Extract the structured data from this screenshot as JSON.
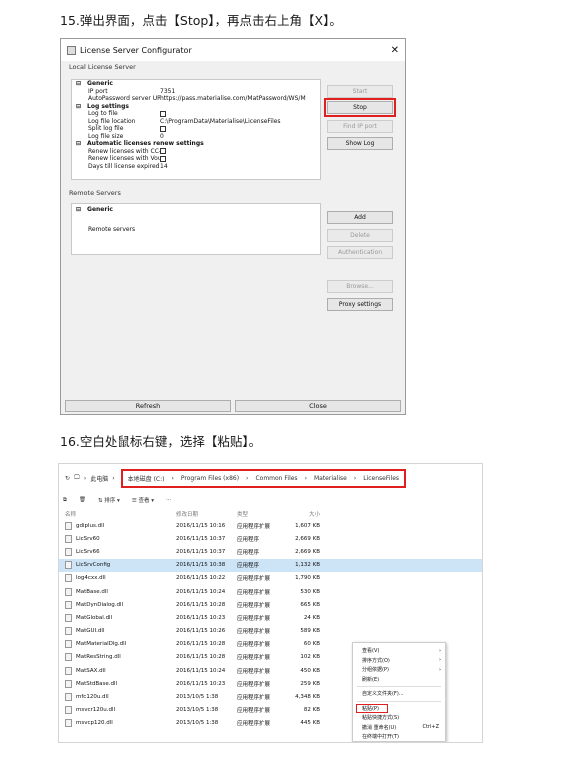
{
  "steps": {
    "step15": "15.弹出界面，点击【Stop】，再点击右上角【X】。",
    "step16": "16.空白处鼠标右键，选择【粘贴】。"
  },
  "dialog": {
    "title": "License Server Configurator",
    "close": "✕",
    "local_section": "Local License Server",
    "rows": [
      {
        "type": "header",
        "label": "Generic"
      },
      {
        "type": "prop",
        "key": "IP port",
        "value": "7351"
      },
      {
        "type": "prop",
        "key": "AutoPassword server URL",
        "value": "https://pass.materialise.com/MatPassword/WS/M"
      },
      {
        "type": "header",
        "label": "Log settings"
      },
      {
        "type": "check",
        "key": "Log to file",
        "value": ""
      },
      {
        "type": "prop",
        "key": "Log file location",
        "value": "C:\\ProgramData\\Materialise\\LicenseFiles"
      },
      {
        "type": "check",
        "key": "Split log file",
        "value": ""
      },
      {
        "type": "prop",
        "key": "Log file size",
        "value": "0"
      },
      {
        "type": "header",
        "label": "Automatic licenses renew settings"
      },
      {
        "type": "check",
        "key": "Renew licenses with CC-key",
        "value": ""
      },
      {
        "type": "check",
        "key": "Renew licenses with Vouch...",
        "value": ""
      },
      {
        "type": "prop",
        "key": "Days till license expired",
        "value": "14"
      }
    ],
    "buttons": {
      "start": "Start",
      "stop": "Stop",
      "find_ip": "Find IP port",
      "show_log": "Show Log"
    },
    "remote_section": "Remote Servers",
    "remote_generic": "Generic",
    "remote_servers": "Remote servers",
    "remote_buttons": {
      "add": "Add",
      "delete": "Delete",
      "auth": "Authentication",
      "browse": "Browse...",
      "proxy": "Proxy settings"
    },
    "refresh": "Refresh",
    "close_btn": "Close"
  },
  "explorer": {
    "crumbs": [
      "此电脑",
      "本地磁盘 (C:)",
      "Program Files (x86)",
      "Common Files",
      "Materialise",
      "LicenseFiles"
    ],
    "toolbar": {
      "sort": "排序",
      "view": "查看",
      "more": "···"
    },
    "headers": {
      "name": "名称",
      "date": "修改日期",
      "type": "类型",
      "size": "大小"
    },
    "files": [
      {
        "name": "gdiplus.dll",
        "date": "2016/11/15 10:16",
        "type": "应用程序扩展",
        "size": "1,607 KB"
      },
      {
        "name": "LicSrv60",
        "date": "2016/11/15 10:37",
        "type": "应用程序",
        "size": "2,669 KB"
      },
      {
        "name": "LicSrv66",
        "date": "2016/11/15 10:37",
        "type": "应用程序",
        "size": "2,669 KB"
      },
      {
        "name": "LicSrvConfig",
        "date": "2016/11/15 10:38",
        "type": "应用程序",
        "size": "1,132 KB",
        "selected": true
      },
      {
        "name": "log4cxx.dll",
        "date": "2016/11/15 10:22",
        "type": "应用程序扩展",
        "size": "1,790 KB"
      },
      {
        "name": "MatBase.dll",
        "date": "2016/11/15 10:24",
        "type": "应用程序扩展",
        "size": "530 KB"
      },
      {
        "name": "MatDynDialog.dll",
        "date": "2016/11/15 10:28",
        "type": "应用程序扩展",
        "size": "665 KB"
      },
      {
        "name": "MatGlobal.dll",
        "date": "2016/11/15 10:23",
        "type": "应用程序扩展",
        "size": "24 KB"
      },
      {
        "name": "MatGUI.dll",
        "date": "2016/11/15 10:26",
        "type": "应用程序扩展",
        "size": "589 KB"
      },
      {
        "name": "MatMaterialDlg.dll",
        "date": "2016/11/15 10:28",
        "type": "应用程序扩展",
        "size": "60 KB"
      },
      {
        "name": "MatResString.dll",
        "date": "2016/11/15 10:28",
        "type": "应用程序扩展",
        "size": "102 KB"
      },
      {
        "name": "MatSAX.dll",
        "date": "2016/11/15 10:24",
        "type": "应用程序扩展",
        "size": "450 KB"
      },
      {
        "name": "MatStdBase.dll",
        "date": "2016/11/15 10:23",
        "type": "应用程序扩展",
        "size": "259 KB"
      },
      {
        "name": "mfc120u.dll",
        "date": "2013/10/5 1:38",
        "type": "应用程序扩展",
        "size": "4,348 KB"
      },
      {
        "name": "msvcr120u.dll",
        "date": "2013/10/5 1:38",
        "type": "应用程序扩展",
        "size": "82 KB"
      },
      {
        "name": "msvcp120.dll",
        "date": "2013/10/5 1:38",
        "type": "应用程序扩展",
        "size": "445 KB"
      }
    ],
    "menu": {
      "view": "查看(V)",
      "sort": "排序方式(O)",
      "group": "分组依据(P)",
      "refresh": "刷新(E)",
      "custom": "自定义文件夹(F)...",
      "paste": "粘贴(P)",
      "paste_shortcut": "粘贴快捷方式(S)",
      "undo": "撤消 重命名(U)",
      "undo_key": "Ctrl+Z",
      "terminal": "在终端中打开(T)"
    }
  }
}
